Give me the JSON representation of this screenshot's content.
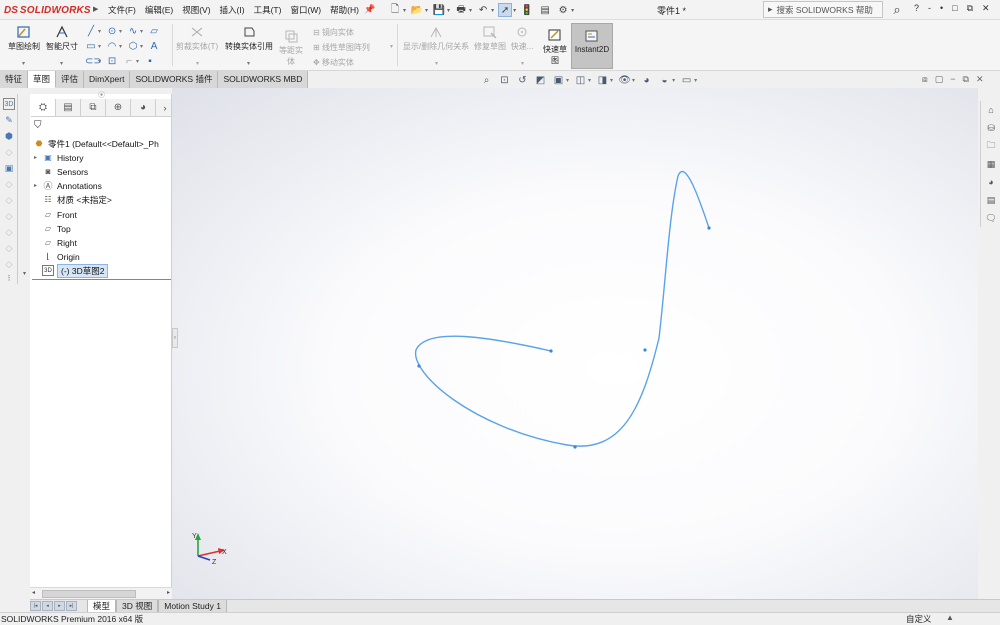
{
  "app": {
    "logo_text": "SOLIDWORKS",
    "logo_mark": "DS",
    "document_title": "零件1 *",
    "search_placeholder": "搜索 SOLIDWORKS 帮助"
  },
  "menu": [
    "文件(F)",
    "编辑(E)",
    "视图(V)",
    "插入(I)",
    "工具(T)",
    "窗口(W)",
    "帮助(H)"
  ],
  "title_right": [
    "?",
    "-",
    "•",
    "□",
    "⧉",
    "✕"
  ],
  "ribbon": {
    "sketch_label": "草图绘制",
    "smart_dim_label": "智能尺寸",
    "trim_label": "剪裁实体(T)",
    "convert_label": "转换实体引用",
    "offset_label": "等距实体",
    "mirror_label": "镜向实体",
    "linear_pattern_label": "线性草图阵列",
    "move_label": "移动实体",
    "relations_label": "显示/删除几何关系",
    "repair_label": "修复草图",
    "quick_snaps_label": "快速...",
    "rapid_sketch_label": "快速草图",
    "instant2d_label": "Instant2D"
  },
  "tabs": [
    {
      "label": "特征",
      "active": false
    },
    {
      "label": "草图",
      "active": true
    },
    {
      "label": "评估",
      "active": false
    },
    {
      "label": "DimXpert",
      "active": false
    },
    {
      "label": "SOLIDWORKS 插件",
      "active": false
    },
    {
      "label": "SOLIDWORKS MBD",
      "active": false
    }
  ],
  "feature_tree": {
    "root": "零件1  (Default<<Default>_Ph",
    "items": [
      {
        "label": "History",
        "icon": "history-icon",
        "expandable": true
      },
      {
        "label": "Sensors",
        "icon": "sensors-icon",
        "expandable": false
      },
      {
        "label": "Annotations",
        "icon": "annotations-icon",
        "expandable": true
      },
      {
        "label": "材质 <未指定>",
        "icon": "material-icon",
        "expandable": false
      },
      {
        "label": "Front",
        "icon": "plane-icon",
        "expandable": false
      },
      {
        "label": "Top",
        "icon": "plane-icon",
        "expandable": false
      },
      {
        "label": "Right",
        "icon": "plane-icon",
        "expandable": false
      },
      {
        "label": "Origin",
        "icon": "origin-icon",
        "expandable": false
      },
      {
        "label": "(-) 3D草图2",
        "icon": "3d-sketch-icon",
        "expandable": false,
        "selected": true
      }
    ]
  },
  "triad": {
    "x_label": "X",
    "y_label": "Y",
    "z_label": "Z"
  },
  "bottom_tabs": [
    {
      "label": "模型",
      "active": true
    },
    {
      "label": "3D 视图",
      "active": false
    },
    {
      "label": "Motion Study 1",
      "active": false
    }
  ],
  "status": {
    "left": "SOLIDWORKS Premium 2016 x64 版",
    "units": "自定义",
    "arrow": "▲"
  },
  "colors": {
    "accent": "#1f6fc0",
    "curve": "#5aa3e8",
    "brand_red": "#d42a24",
    "selection": "#d6e6f7"
  }
}
